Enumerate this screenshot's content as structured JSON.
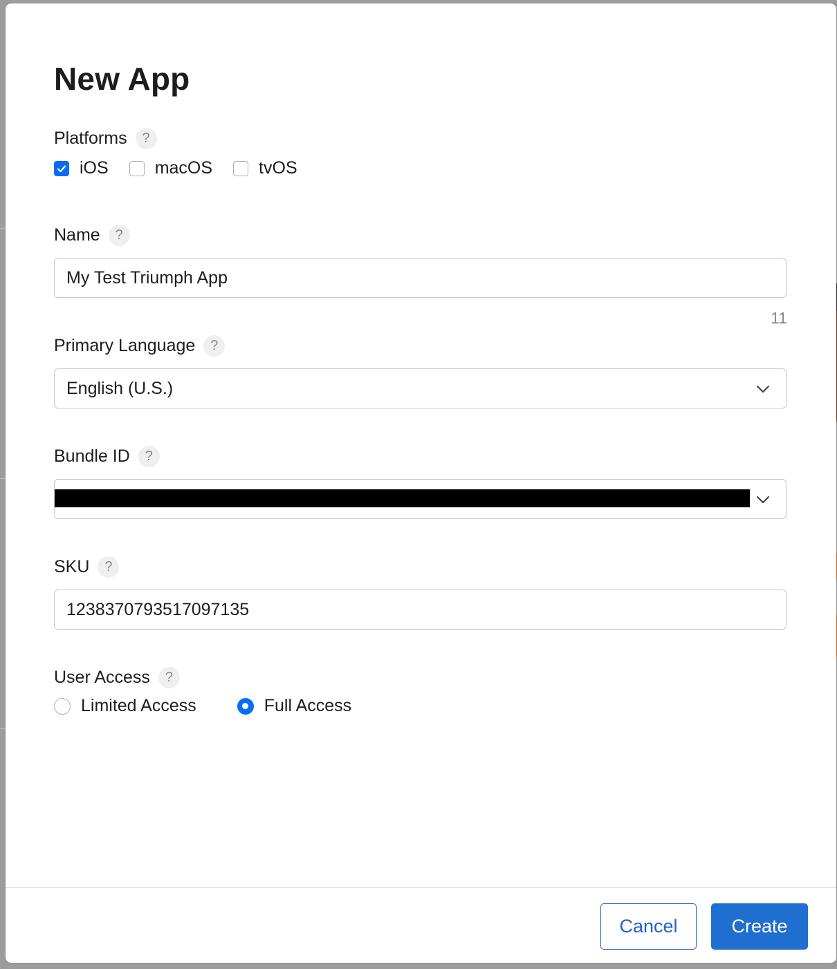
{
  "dialog": {
    "title": "New App"
  },
  "platforms": {
    "label": "Platforms",
    "help": "?",
    "options": [
      {
        "label": "iOS",
        "checked": true
      },
      {
        "label": "macOS",
        "checked": false
      },
      {
        "label": "tvOS",
        "checked": false
      }
    ]
  },
  "name": {
    "label": "Name",
    "help": "?",
    "value": "My Test Triumph App",
    "counter": "11"
  },
  "primary_language": {
    "label": "Primary Language",
    "help": "?",
    "value": "English (U.S.)"
  },
  "bundle_id": {
    "label": "Bundle ID",
    "help": "?"
  },
  "sku": {
    "label": "SKU",
    "help": "?",
    "value": "1238370793517097135"
  },
  "user_access": {
    "label": "User Access",
    "help": "?",
    "options": [
      {
        "label": "Limited Access",
        "selected": false
      },
      {
        "label": "Full Access",
        "selected": true
      }
    ]
  },
  "footer": {
    "cancel_label": "Cancel",
    "create_label": "Create"
  },
  "colors": {
    "accent": "#0a6cf2",
    "primary_button": "#1f6fd1",
    "secondary_button_text": "#1a64c6"
  }
}
